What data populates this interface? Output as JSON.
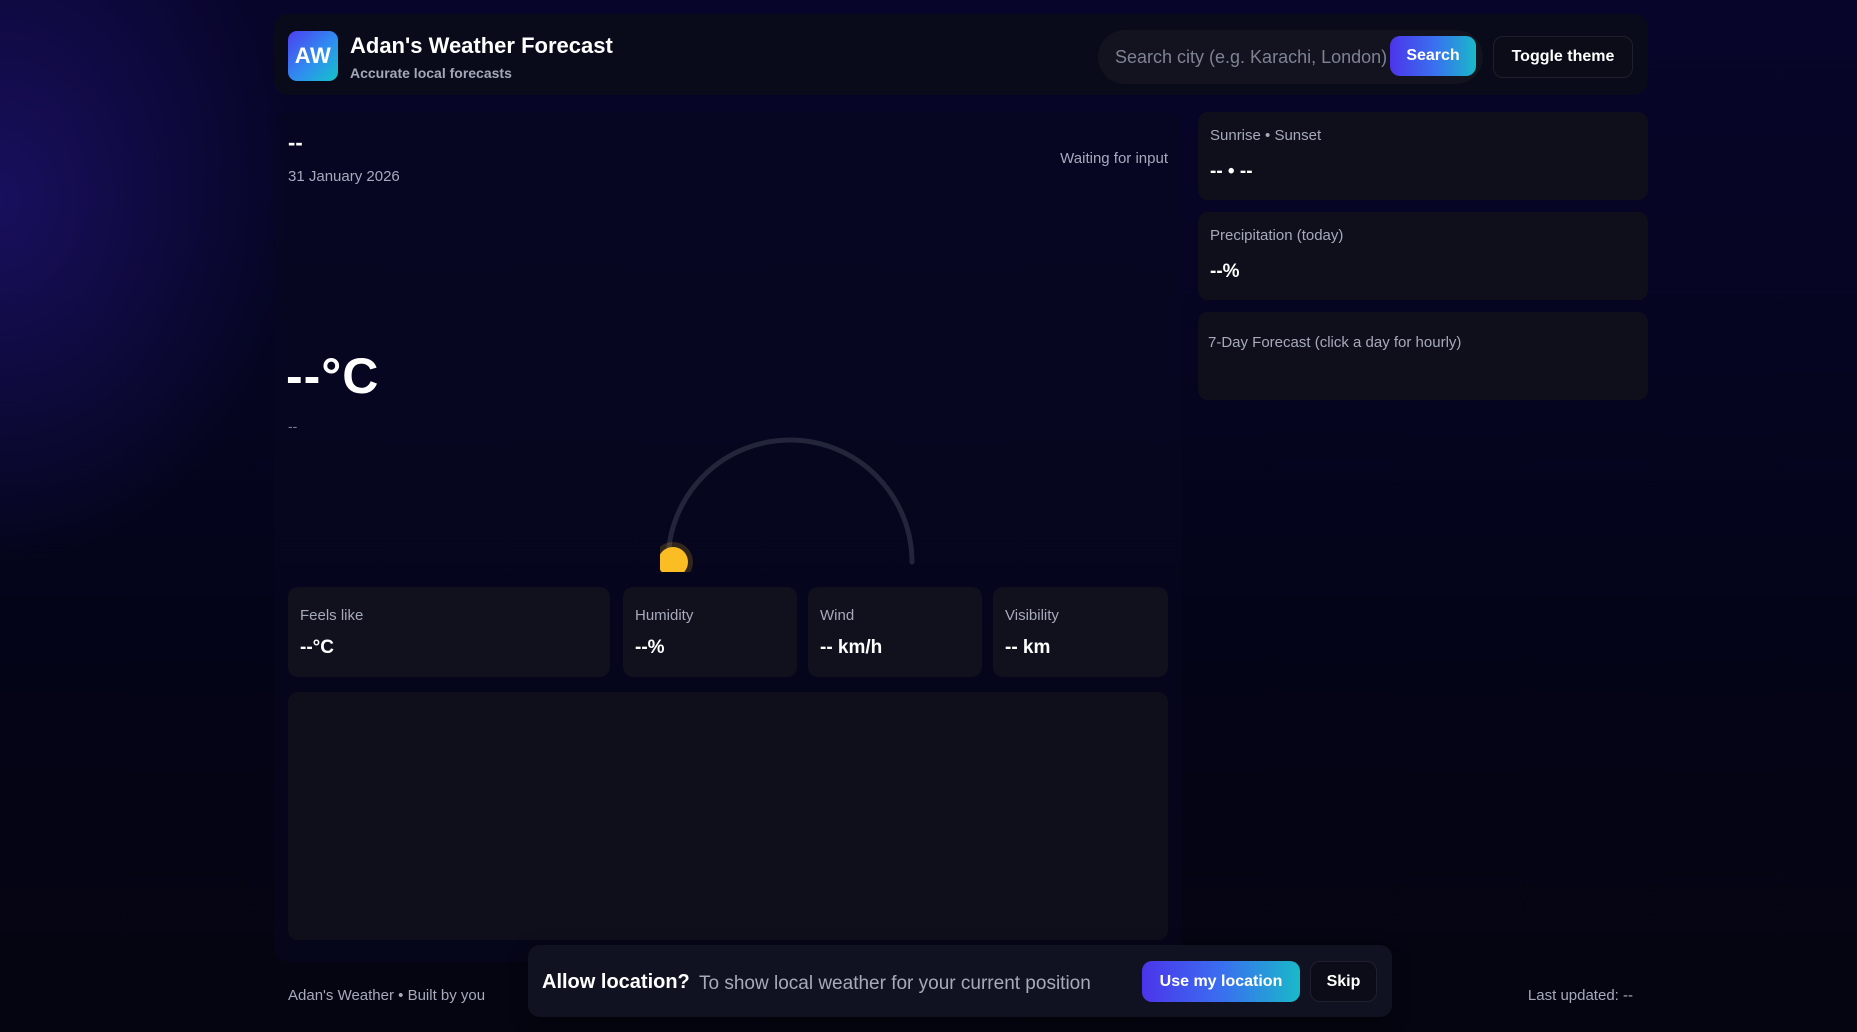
{
  "header": {
    "logo_text": "AW",
    "title": "Adan's Weather Forecast",
    "subtitle": "Accurate local forecasts",
    "search_placeholder": "Search city (e.g. Karachi, London)",
    "search_label": "Search",
    "theme_label": "Toggle theme"
  },
  "current": {
    "city": "--",
    "date": "31 January 2026",
    "status": "Waiting for input",
    "temperature": "--°C",
    "condition": "--"
  },
  "metrics": [
    {
      "label": "Feels like",
      "value": "--°C"
    },
    {
      "label": "Humidity",
      "value": "--%"
    },
    {
      "label": "Wind",
      "value": "-- km/h"
    },
    {
      "label": "Visibility",
      "value": "-- km"
    }
  ],
  "side": {
    "sun": {
      "label": "Sunrise • Sunset",
      "value": "-- • --"
    },
    "precip": {
      "label": "Precipitation (today)",
      "value": "--%"
    },
    "forecast": {
      "label": "7-Day Forecast (click a day for hourly)"
    }
  },
  "footer": {
    "left": "Adan's Weather • Built by you",
    "right": "Last updated: --"
  },
  "location_prompt": {
    "title": "Allow location?",
    "text": "To show local weather for your current position",
    "use_label": "Use my location",
    "skip_label": "Skip"
  },
  "colors": {
    "accent_start": "#4b35ea",
    "accent_end": "#19b9c9",
    "sun": "#fbbd24",
    "arc": "#23253a"
  }
}
